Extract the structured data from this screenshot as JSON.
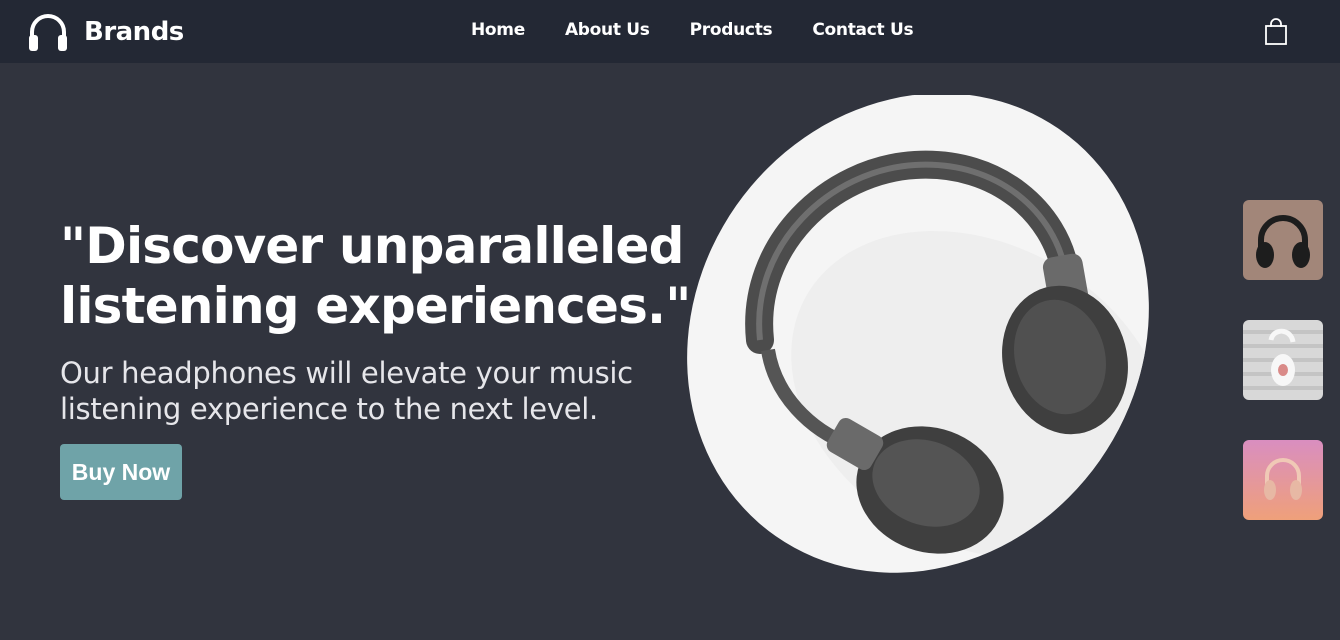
{
  "header": {
    "brand": "Brands",
    "brand_icon": "headphones-icon",
    "nav": [
      {
        "label": "Home"
      },
      {
        "label": "About Us"
      },
      {
        "label": "Products"
      },
      {
        "label": "Contact Us"
      }
    ],
    "cart_icon": "shopping-bag-icon"
  },
  "hero": {
    "title_line1": "\"Discover unparalleled",
    "title_line2": "listening experiences.\"",
    "subtitle_line1": "Our headphones will elevate your music",
    "subtitle_line2": "listening experience to the next level.",
    "cta_label": "Buy Now"
  },
  "thumbnails": [
    {
      "name": "black-headphones-thumbnail"
    },
    {
      "name": "white-headphones-thumbnail"
    },
    {
      "name": "pink-headphones-thumbnail"
    }
  ],
  "colors": {
    "nav_bg": "#232834",
    "page_bg": "#31343e",
    "accent": "#6fa3a8"
  }
}
